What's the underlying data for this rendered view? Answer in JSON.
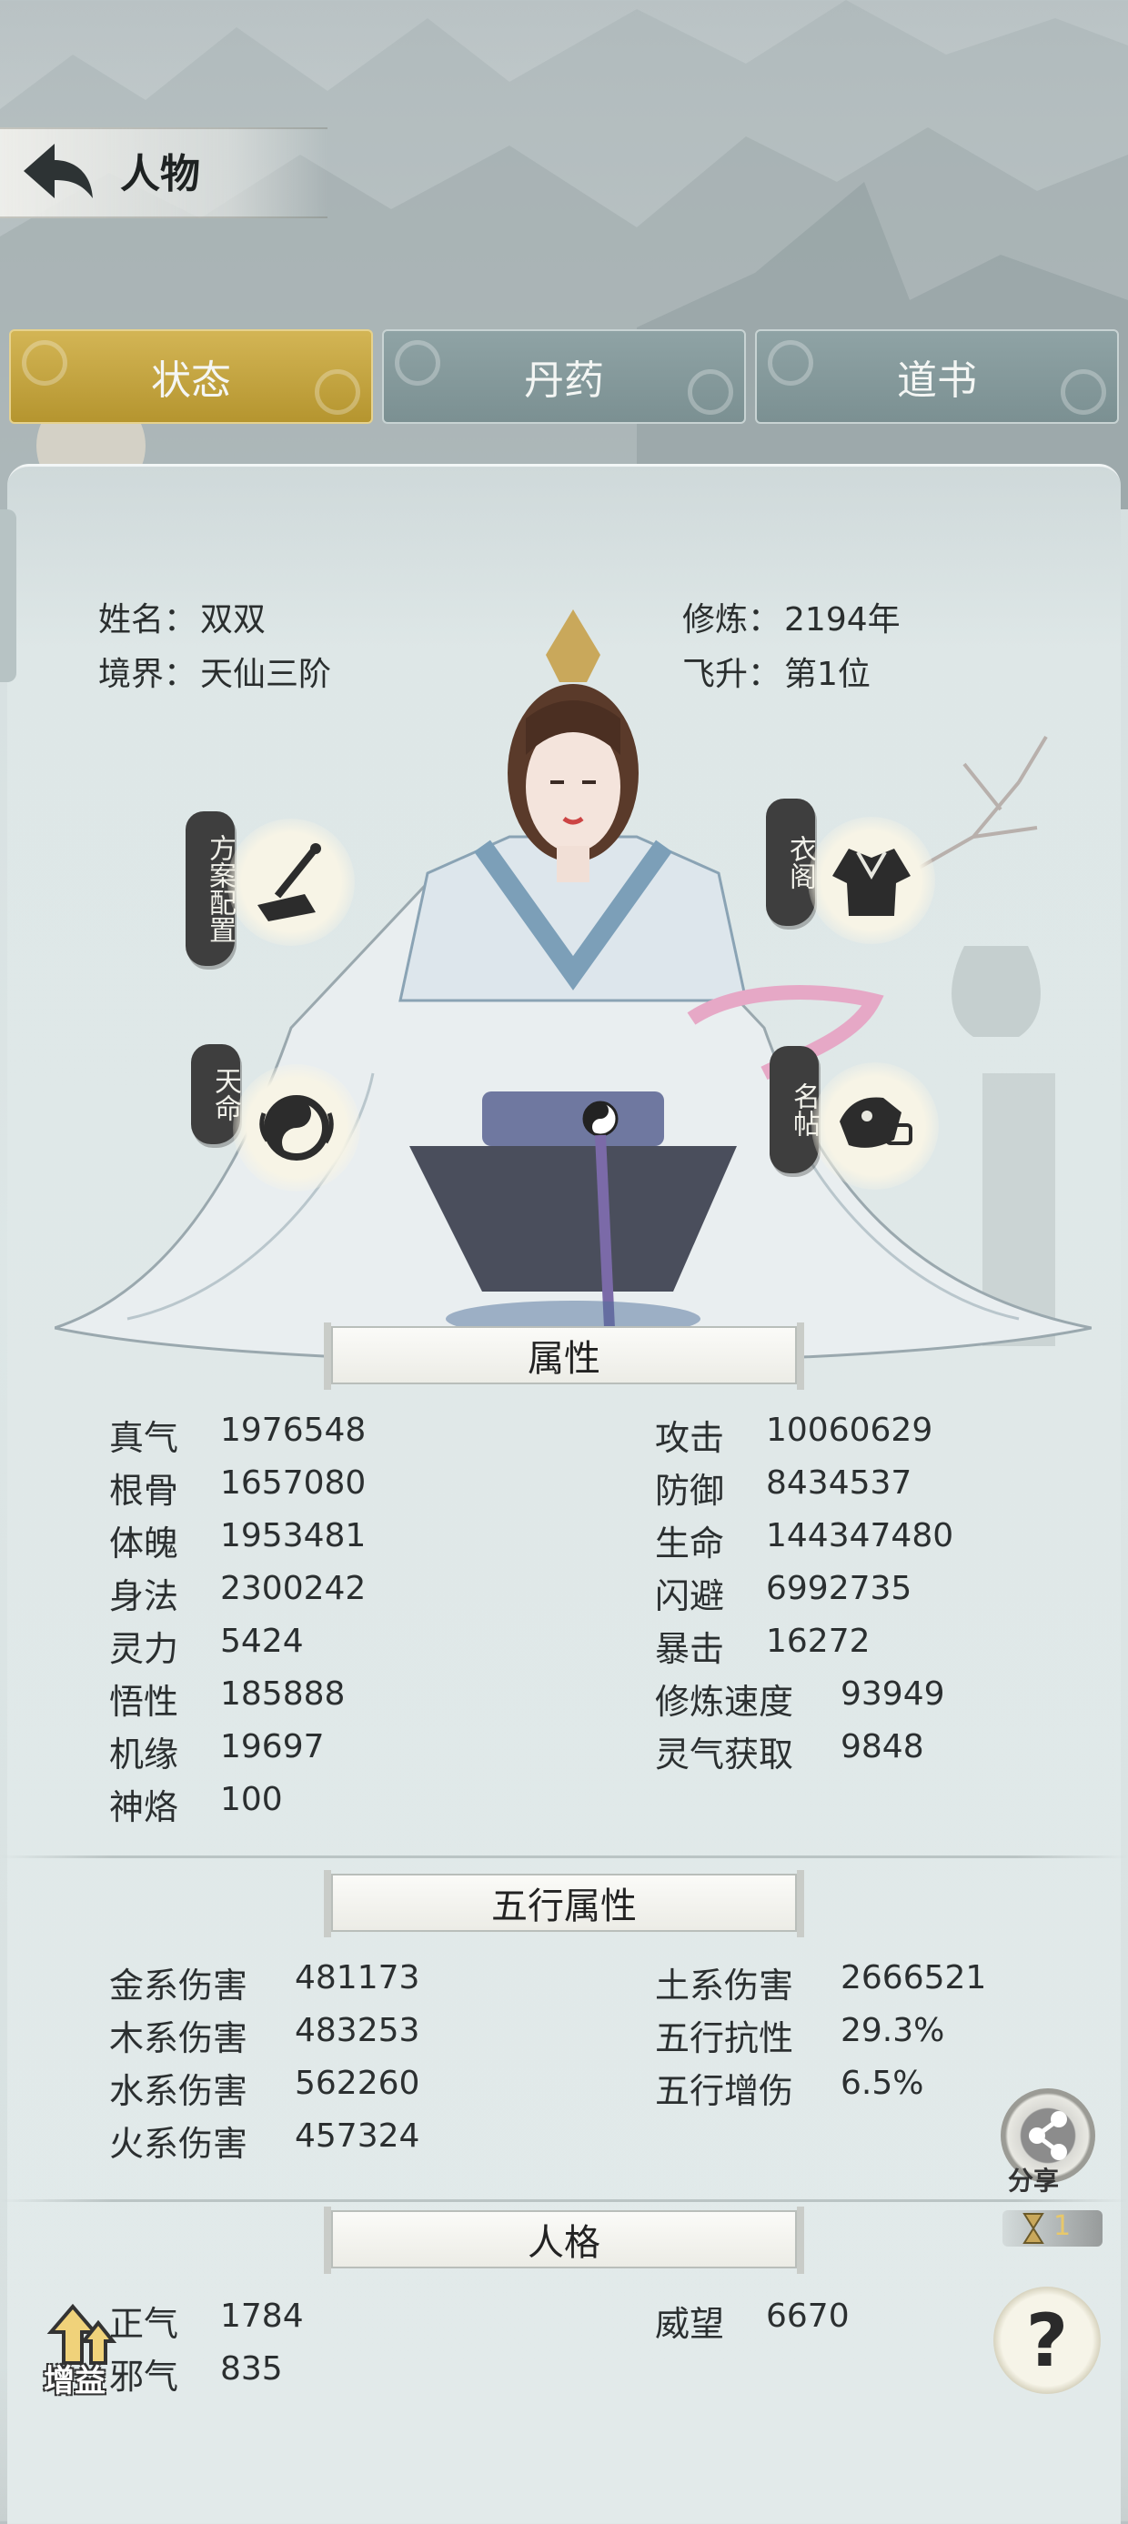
{
  "header": {
    "title": "人物"
  },
  "tabs": [
    {
      "label": "状态",
      "active": true
    },
    {
      "label": "丹药",
      "active": false
    },
    {
      "label": "道书",
      "active": false
    }
  ],
  "profile": {
    "name_label": "姓名：",
    "name": "双双",
    "realm_label": "境界：",
    "realm": "天仙三阶",
    "cultivation_label": "修炼：",
    "cultivation": "2194年",
    "ascension_label": "飞升：",
    "ascension": "第1位"
  },
  "features": {
    "plan": "方案配置",
    "wardrobe": "衣阁",
    "fate": "天命",
    "card": "名帖"
  },
  "sections": {
    "attributes": "属性",
    "five_elements": "五行属性",
    "personality": "人格"
  },
  "attributes_left": [
    {
      "label": "真气",
      "value": "1976548"
    },
    {
      "label": "根骨",
      "value": "1657080"
    },
    {
      "label": "体魄",
      "value": "1953481"
    },
    {
      "label": "身法",
      "value": "2300242"
    },
    {
      "label": "灵力",
      "value": "5424"
    },
    {
      "label": "悟性",
      "value": "185888"
    },
    {
      "label": "机缘",
      "value": "19697"
    },
    {
      "label": "神烙",
      "value": "100"
    }
  ],
  "attributes_right": [
    {
      "label": "攻击",
      "value": "10060629"
    },
    {
      "label": "防御",
      "value": "8434537"
    },
    {
      "label": "生命",
      "value": "144347480"
    },
    {
      "label": "闪避",
      "value": "6992735"
    },
    {
      "label": "暴击",
      "value": "16272"
    },
    {
      "label": "修炼速度",
      "value": "93949"
    },
    {
      "label": "灵气获取",
      "value": "9848"
    }
  ],
  "elements_left": [
    {
      "label": "金系伤害",
      "value": "481173"
    },
    {
      "label": "木系伤害",
      "value": "483253"
    },
    {
      "label": "水系伤害",
      "value": "562260"
    },
    {
      "label": "火系伤害",
      "value": "457324"
    }
  ],
  "elements_right": [
    {
      "label": "土系伤害",
      "value": "2666521"
    },
    {
      "label": "五行抗性",
      "value": "29.3%"
    },
    {
      "label": "五行增伤",
      "value": "6.5%"
    }
  ],
  "personality_left": [
    {
      "label": "正气",
      "value": "1784"
    },
    {
      "label": "邪气",
      "value": "835"
    }
  ],
  "personality_right": [
    {
      "label": "威望",
      "value": "6670"
    }
  ],
  "side_buttons": {
    "share_label": "分享",
    "counter": "1",
    "help_symbol": "?",
    "buff_label": "增益"
  },
  "icons": [
    "back-arrow-icon",
    "calligraphy-scroll-icon",
    "robe-icon",
    "taiji-icon",
    "mask-icon",
    "share-icon",
    "hourglass-icon",
    "question-icon",
    "up-arrow-icon"
  ],
  "colors": {
    "active_tab": "#c9a83e",
    "inactive_tab": "#859a9c",
    "panel": "#dde6e6",
    "text": "#2b2f30"
  }
}
